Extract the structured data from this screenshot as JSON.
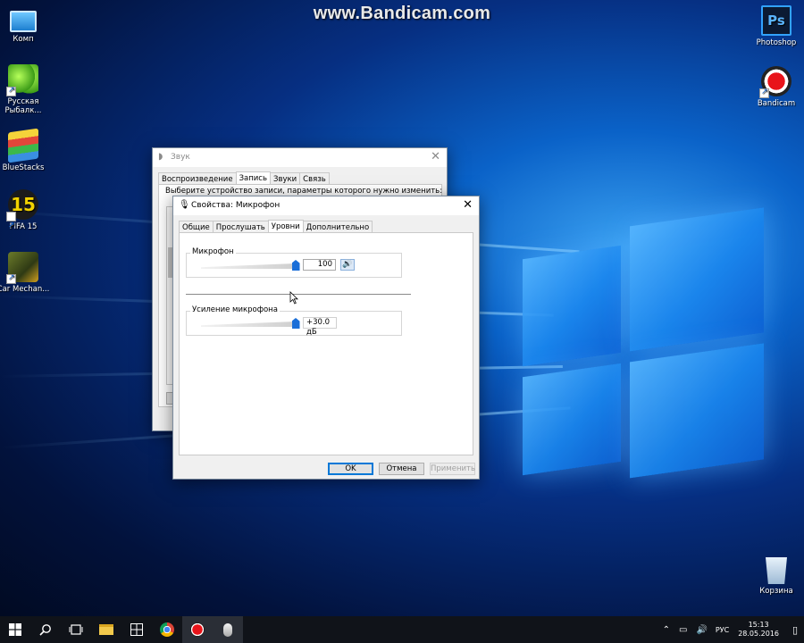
{
  "watermark": "www.Bandicam.com",
  "desktop_icons": {
    "computer": "Комп",
    "fishing": "Русская Рыбалк...",
    "bluestacks": "BlueStacks",
    "fifa": "FIFA 15",
    "fifa_badge": "15",
    "car": "Car Mechan...",
    "photoshop": "Photoshop",
    "photoshop_badge": "Ps",
    "bandicam": "Bandicam",
    "recycle": "Корзина"
  },
  "sound_window": {
    "title": "Звук",
    "tabs": [
      "Воспроизведение",
      "Запись",
      "Звуки",
      "Связь"
    ],
    "active_tab": 1,
    "instruction": "Выберите устройство записи, параметры которого нужно изменить:"
  },
  "mic_window": {
    "title": "Свойства: Микрофон",
    "tabs": [
      "Общие",
      "Прослушать",
      "Уровни",
      "Дополнительно"
    ],
    "active_tab": 2,
    "microphone": {
      "label": "Микрофон",
      "value": "100",
      "level": 1.0
    },
    "boost": {
      "label": "Усиление микрофона",
      "value": "+30.0 дБ",
      "level": 1.0
    },
    "buttons": {
      "ok": "OK",
      "cancel": "Отмена",
      "apply": "Применить"
    }
  },
  "taskbar": {
    "language": "РУС",
    "time": "15:13",
    "date": "28.05.2016"
  },
  "colors": {
    "accent": "#0078d7",
    "taskbar": "#101319",
    "slider_thumb": "#1a6ed8"
  }
}
